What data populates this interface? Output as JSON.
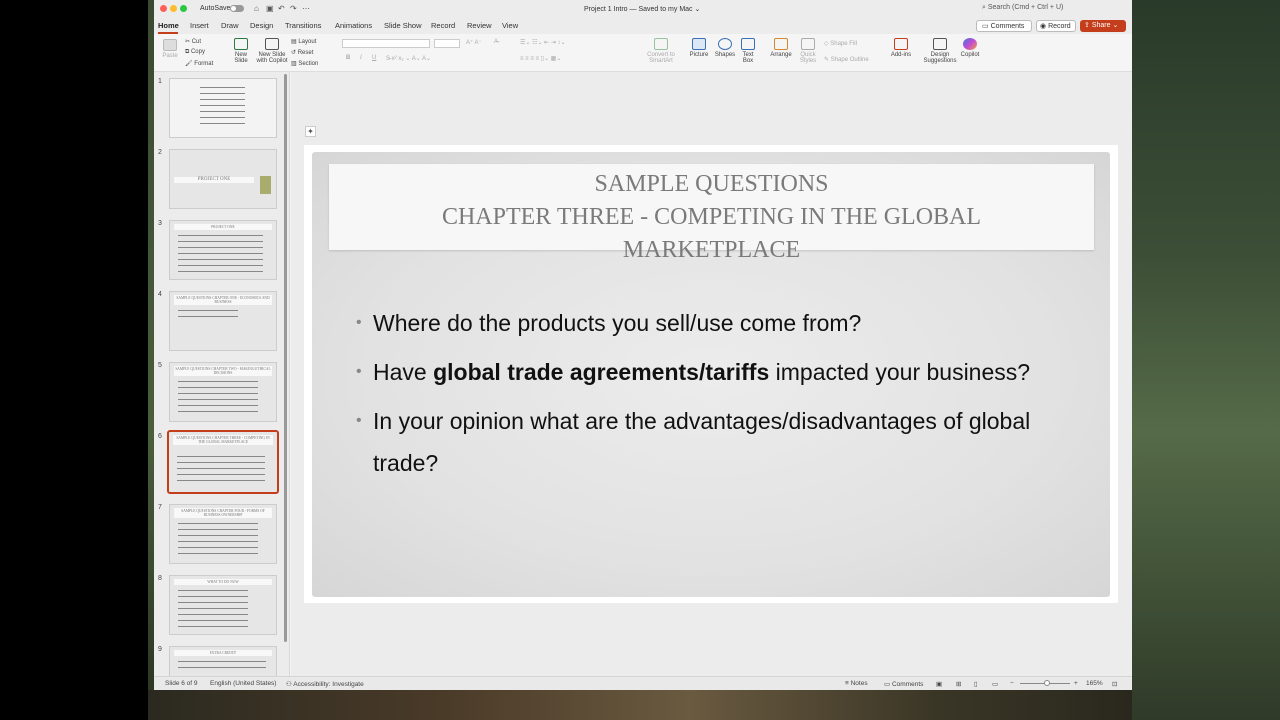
{
  "window": {
    "autosave_label": "AutoSave",
    "doc_title": "Project 1 Intro — Saved to my Mac ⌄",
    "search_placeholder": "Search (Cmd + Ctrl + U)"
  },
  "tabs": [
    "Home",
    "Insert",
    "Draw",
    "Design",
    "Transitions",
    "Animations",
    "Slide Show",
    "Record",
    "Review",
    "View"
  ],
  "header_buttons": {
    "comments": "Comments",
    "record": "Record",
    "share": "Share"
  },
  "ribbon": {
    "paste": "Paste",
    "cut": "Cut",
    "copy": "Copy",
    "format": "Format",
    "new_slide": "New Slide",
    "new_slide_copilot": "New Slide with Copilot",
    "layout": "Layout",
    "reset": "Reset",
    "section": "Section",
    "convert_smartart": "Convert to SmartArt",
    "picture": "Picture",
    "shapes": "Shapes",
    "text_box": "Text Box",
    "arrange": "Arrange",
    "quick_styles": "Quick Styles",
    "shape_fill": "Shape Fill",
    "shape_outline": "Shape Outline",
    "add_ins": "Add-ins",
    "design_suggestions": "Design Suggestions",
    "copilot": "Copilot",
    "bold": "B",
    "italic": "I",
    "underline": "U"
  },
  "thumbnails": [
    {
      "num": "1",
      "title": ""
    },
    {
      "num": "2",
      "title": "PROJECT ONE"
    },
    {
      "num": "3",
      "title": "PROJECT ONE"
    },
    {
      "num": "4",
      "title": "SAMPLE QUESTIONS CHAPTER ONE - ECONOMICS AND BUSINESS"
    },
    {
      "num": "5",
      "title": "SAMPLE QUESTIONS CHAPTER TWO - MAKING ETHICAL DECISIONS"
    },
    {
      "num": "6",
      "title": "SAMPLE QUESTIONS CHAPTER THREE - COMPETING IN THE GLOBAL MARKETPLACE"
    },
    {
      "num": "7",
      "title": "SAMPLE QUESTIONS CHAPTER FOUR - FORMS OF BUSINESS OWNERSHIP"
    },
    {
      "num": "8",
      "title": "WHAT TO DO NOW"
    },
    {
      "num": "9",
      "title": "EXTRA CREDIT!"
    }
  ],
  "slide": {
    "title_line1": "SAMPLE QUESTIONS",
    "title_line2": "CHAPTER THREE - COMPETING IN THE GLOBAL",
    "title_line3": "MARKETPLACE",
    "bullet1": "Where do the products you sell/use come from?",
    "bullet2_pre": "Have ",
    "bullet2_bold": "global trade agreements/tariffs",
    "bullet2_post": " impacted your business?",
    "bullet3": "In your opinion what are the advantages/disadvantages of global trade?"
  },
  "statusbar": {
    "slide_count": "Slide 6 of 9",
    "language": "English (United States)",
    "accessibility": "Accessibility: Investigate",
    "notes": "Notes",
    "comments": "Comments",
    "zoom": "165%"
  },
  "colors": {
    "accent": "#c43e1c",
    "share_bg": "#c43e1c"
  }
}
